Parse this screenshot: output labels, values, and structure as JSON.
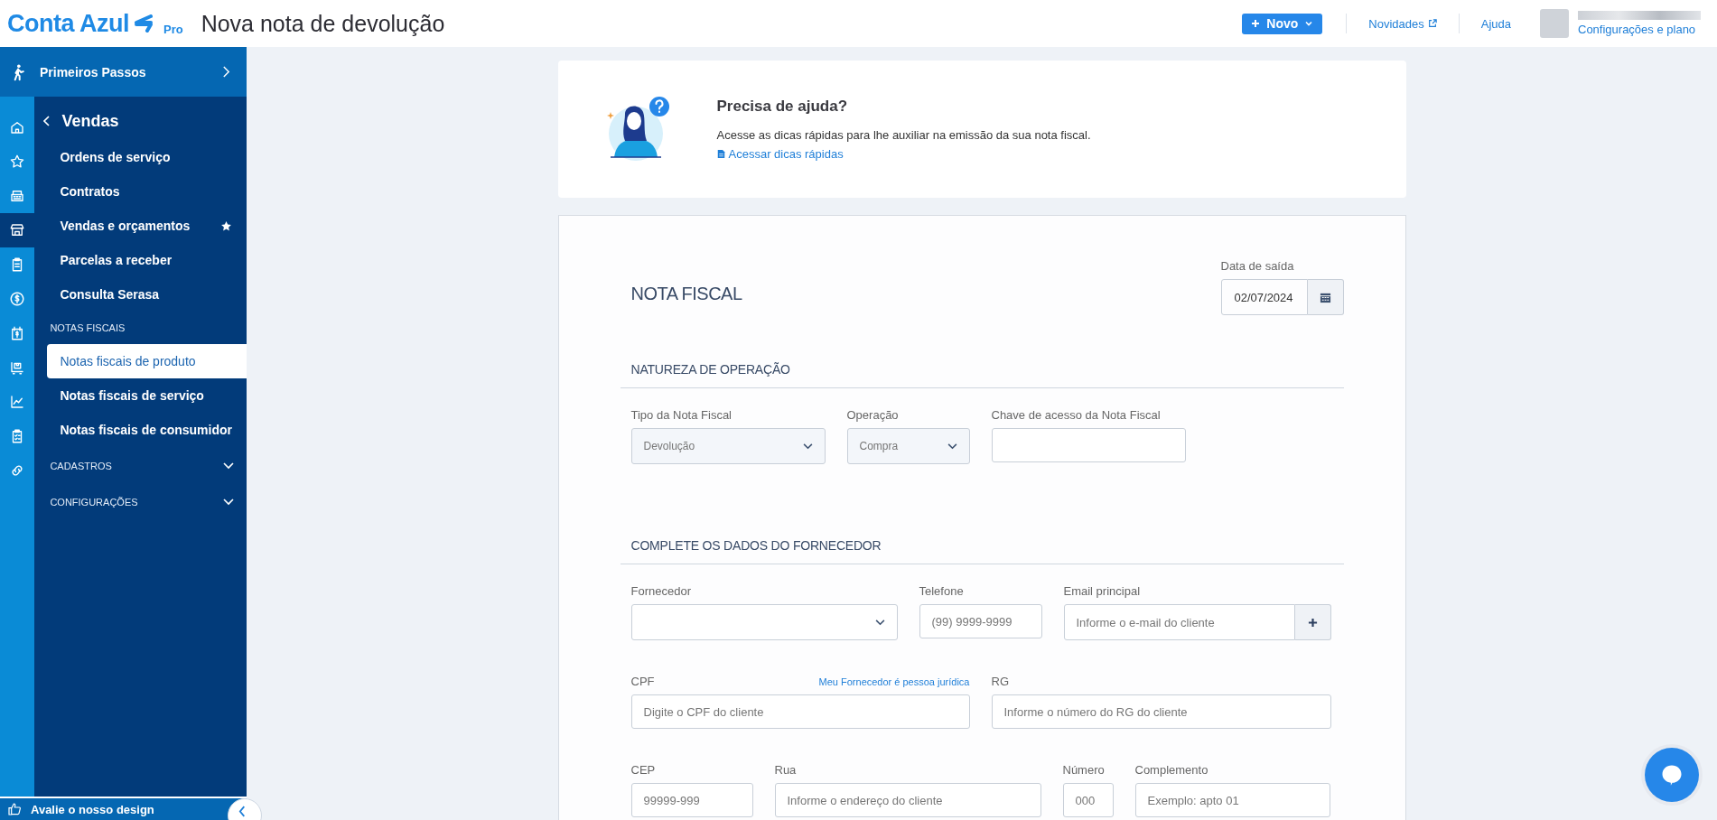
{
  "header": {
    "logo": {
      "text": "Conta Azul",
      "badge": "Pro"
    },
    "page_title": "Nova nota de devolução",
    "new_button": "Novo",
    "links": [
      {
        "label": "Novidades",
        "external": true
      },
      {
        "label": "Ajuda",
        "external": false
      }
    ],
    "account_link": "Configurações e plano"
  },
  "sidebar": {
    "top_item": "Primeiros Passos",
    "rail": [
      {
        "selected": false
      },
      {
        "selected": false
      },
      {
        "selected": false
      },
      {
        "selected": true
      },
      {
        "selected": false
      },
      {
        "selected": false
      },
      {
        "selected": false
      },
      {
        "selected": false
      },
      {
        "selected": false
      },
      {
        "selected": false
      },
      {
        "selected": false
      }
    ],
    "menu_title": "Vendas",
    "items": [
      {
        "label": "Ordens de serviço",
        "selected": false,
        "favorite": false
      },
      {
        "label": "Contratos",
        "selected": false,
        "favorite": false
      },
      {
        "label": "Vendas e orçamentos",
        "selected": false,
        "favorite": true
      },
      {
        "label": "Parcelas a receber",
        "selected": false,
        "favorite": false
      },
      {
        "label": "Consulta Serasa",
        "selected": false,
        "favorite": false
      }
    ],
    "group": {
      "heading": "NOTAS FISCAIS",
      "items": [
        {
          "label": "Notas fiscais de produto",
          "selected": true,
          "favorite": false
        },
        {
          "label": "Notas fiscais de serviço",
          "selected": false,
          "favorite": false
        },
        {
          "label": "Notas fiscais de consumidor",
          "selected": false,
          "favorite": false
        }
      ]
    },
    "collapsibles": [
      {
        "label": "CADASTROS",
        "expanded": false
      },
      {
        "label": "CONFIGURAÇÕES",
        "expanded": false
      }
    ],
    "feedback": "Avalie o nosso design"
  },
  "help_card": {
    "title": "Precisa de ajuda?",
    "text": "Acesse as dicas rápidas para lhe auxiliar na emissão da sua nota fiscal.",
    "link": "Acessar dicas rápidas"
  },
  "form": {
    "title": "NOTA FISCAL",
    "date": {
      "label": "Data de saída",
      "value": "02/07/2024"
    },
    "sections": [
      {
        "title": "NATUREZA DE OPERAÇÃO",
        "rows": [
          [
            {
              "kind": "select",
              "label": "Tipo da Nota Fiscal",
              "value": "Devolução",
              "disabled": true
            },
            {
              "kind": "select",
              "label": "Operação",
              "value": "Compra",
              "disabled": true
            },
            {
              "kind": "input",
              "label": "Chave de acesso da Nota Fiscal"
            }
          ]
        ]
      },
      {
        "title": "COMPLETE OS DADOS DO FORNECEDOR",
        "rows": [
          [
            {
              "kind": "select",
              "label": "Fornecedor",
              "disabled": false
            },
            {
              "kind": "input",
              "label": "Telefone",
              "placeholder": "(99) 9999-9999"
            },
            {
              "kind": "addon",
              "label": "Email principal",
              "placeholder": "Informe o e-mail do cliente"
            }
          ],
          [
            {
              "kind": "input",
              "label": "CPF",
              "label_link": "Meu Fornecedor é pessoa jurídica",
              "placeholder": "Digite o CPF do cliente"
            },
            {
              "kind": "input",
              "label": "RG",
              "placeholder": "Informe o número do RG do cliente"
            }
          ],
          [
            {
              "kind": "input",
              "label": "CEP",
              "placeholder": "99999-999"
            },
            {
              "kind": "input",
              "label": "Rua",
              "placeholder": "Informe o endereço do cliente"
            },
            {
              "kind": "input",
              "label": "Número",
              "placeholder": "000"
            },
            {
              "kind": "input",
              "label": "Complemento",
              "placeholder": "Exemplo: apto 01"
            }
          ]
        ]
      }
    ]
  }
}
